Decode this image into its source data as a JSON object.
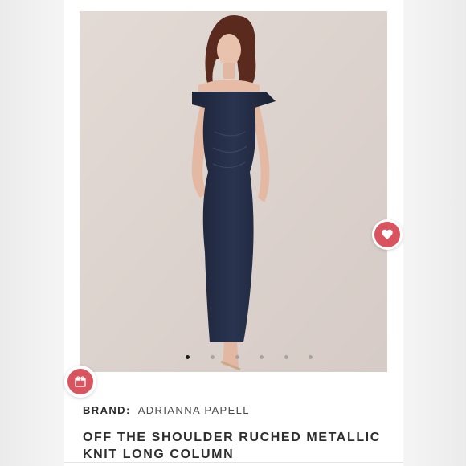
{
  "listing": {
    "brand_label": "BRAND:",
    "brand_value": "ADRIANNA PAPELL",
    "title": "OFF THE SHOULDER RUCHED METALLIC KNIT LONG COLUMN"
  },
  "gallery": {
    "image_count": 6,
    "active_index": 0,
    "image_description": "Model wearing a navy off-the-shoulder long column dress"
  },
  "actions": {
    "like_icon": "heart-icon",
    "gift_icon": "gift-icon",
    "accent_color": "#d9545e"
  }
}
